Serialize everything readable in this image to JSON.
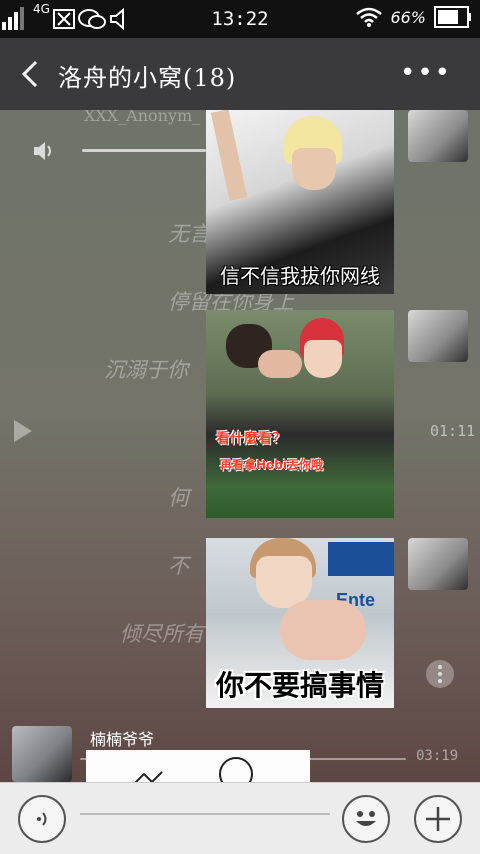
{
  "status": {
    "network": "4G",
    "signal_label": "1",
    "time": "13:22",
    "battery": "66%"
  },
  "header": {
    "title": "洛舟的小窝(18)",
    "more": "•••"
  },
  "music": {
    "artist": "XXX_Anonym_",
    "lyrics": [
      "无言",
      "停留在你身上",
      "沉溺于你",
      "何",
      "不",
      "倾尽所有"
    ],
    "elapsed": "01:11",
    "duration": "03:19"
  },
  "messages": [
    {
      "caption": "信不信我拔你网线"
    },
    {
      "caption_line1": "看什麼看？",
      "caption_line2": "再看拿Hobi丟你哦"
    },
    {
      "caption": "你不要搞事情",
      "sign": "Ente"
    }
  ],
  "incoming": {
    "sender": "楠楠爷爷"
  },
  "colors": {
    "accent": "#e84a3a",
    "header": "#3a3a3c"
  }
}
